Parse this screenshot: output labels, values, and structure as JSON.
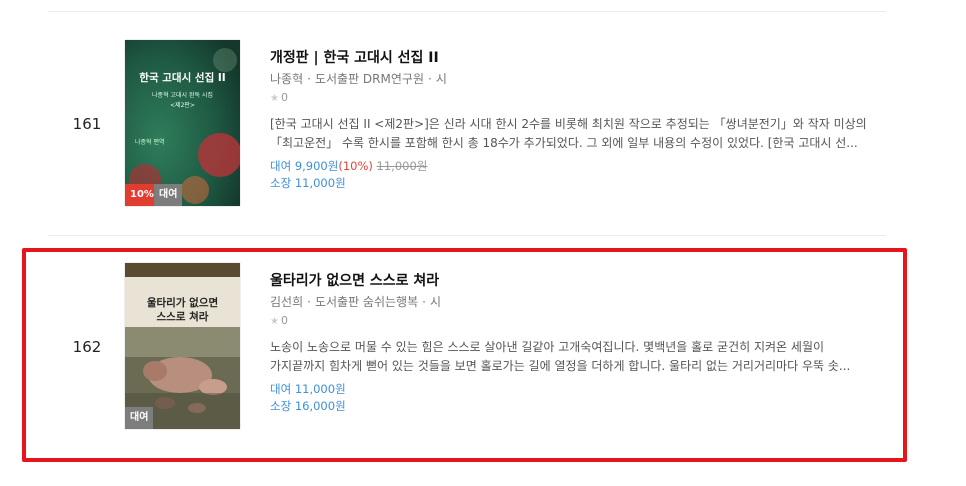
{
  "colors": {
    "highlight": "#e8141b",
    "price_blue": "#3d8fd8",
    "discount_red": "#e4453a",
    "rent_badge": "#7d7d7d",
    "discount_badge": "#e23b2f"
  },
  "items": [
    {
      "rank": "161",
      "title": "개정판 | 한국 고대시 선집 II",
      "author": "나종혁",
      "publisher": "도서출판 DRM연구원",
      "category": "시",
      "rating": "0",
      "desc_line1": "[한국 고대시 선집 II <제2판>]은 신라 시대 한시 2수를 비롯해 최치원 작으로 추정되는 「쌍녀분전기」와 작자 미상의",
      "desc_line2": "「최고운전」 수록 한시를 포함해 한시 총 18수가 추가되었다. 그 외에 일부 내용의 수정이 있었다. [한국 고대시 선...",
      "rent_label": "대여",
      "rent_price": "9,900원",
      "rent_discount": "(10%)",
      "rent_original": "11,000원",
      "own_label": "소장",
      "own_price": "11,000원",
      "cover_title": "한국 고대시 선집 II",
      "cover_sub1": "나종혁 고대시 완독 시집",
      "cover_sub2": "<제2판>",
      "cover_author": "나종혁 편역",
      "badge_discount": "10%",
      "badge_rent": "대여"
    },
    {
      "rank": "162",
      "title": "울타리가 없으면 스스로 쳐라",
      "author": "김선희",
      "publisher": "도서출판 숨쉬는행복",
      "category": "시",
      "rating": "0",
      "desc_line1": "노송이 노송으로 머물 수 있는 힘은 스스로 살아낸 길같아 고개숙여집니다. 몇백년을 홀로 굳건히 지켜온 세월이",
      "desc_line2": "가지끝까지 힘차게 뻗어 있는 것들을 보면 홀로가는 길에 열정을 더하게 합니다. 울타리 없는 거리거리마다 우뚝 솟...",
      "rent_label": "대여",
      "rent_price": "11,000원",
      "own_label": "소장",
      "own_price": "16,000원",
      "cover_title_line1": "울타리가 없으면",
      "cover_title_line2": "스스로 쳐라",
      "badge_rent": "대여"
    }
  ]
}
